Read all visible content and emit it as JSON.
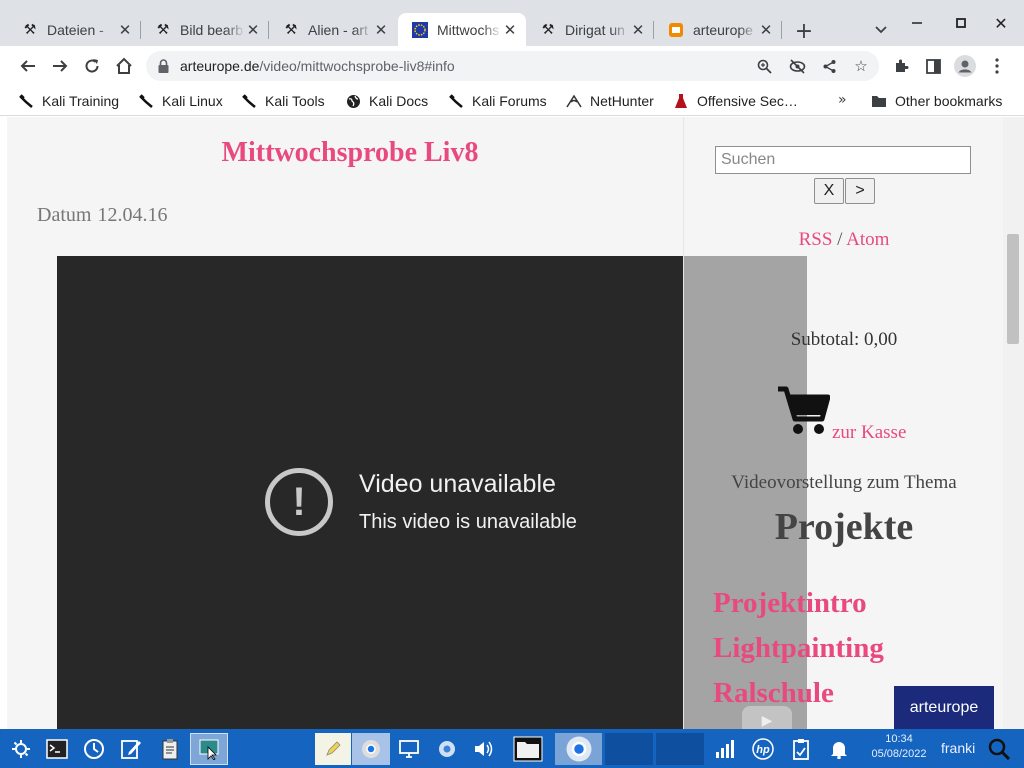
{
  "tabs": [
    {
      "title": "Dateien - ",
      "icon": "hammer-icon",
      "active": false
    },
    {
      "title": "Bild bearb",
      "icon": "hammer-icon",
      "active": false
    },
    {
      "title": "Alien - art",
      "icon": "hammer-icon",
      "active": false
    },
    {
      "title": "Mittwochs",
      "icon": "eu-flag-icon",
      "active": true
    },
    {
      "title": "Dirigat un",
      "icon": "hammer-icon",
      "active": false
    },
    {
      "title": "arteurope",
      "icon": "arteurope-icon",
      "active": false
    }
  ],
  "address": {
    "domain": "arteurope.de",
    "path": "/video/mittwochsprobe-liv8#info"
  },
  "bookmarks": [
    {
      "label": "Kali Training",
      "icon": "kali-dragon-icon"
    },
    {
      "label": "Kali Linux",
      "icon": "kali-dragon-icon"
    },
    {
      "label": "Kali Tools",
      "icon": "kali-dragon-icon"
    },
    {
      "label": "Kali Docs",
      "icon": "globe-icon"
    },
    {
      "label": "Kali Forums",
      "icon": "kali-dragon-icon"
    },
    {
      "label": "NetHunter",
      "icon": "nethunter-icon"
    },
    {
      "label": "Offensive Sec…",
      "icon": "offsec-icon"
    }
  ],
  "bookmarks_more": "»",
  "other_bookmarks": "Other bookmarks",
  "page": {
    "title": "Mittwochsprobe Liv8",
    "date_label": "Datum",
    "date_value": "12.04.16",
    "video_title": "Video unavailable",
    "video_subtitle": "This video is unavailable"
  },
  "sidebar": {
    "search_placeholder": "Suchen",
    "clear_button": "X",
    "submit_button": ">",
    "rss": "RSS",
    "feed_sep": "/",
    "atom": "Atom",
    "subtotal": "Subtotal: 0,00",
    "checkout": "zur Kasse",
    "intro_text": "Videovorstellung zum Thema",
    "heading": "Projekte",
    "links": [
      "Projektintro",
      "Lightpainting",
      "Ralschule"
    ],
    "logo_text": "arteurope"
  },
  "taskbar": {
    "time": "10:34",
    "date": "05/08/2022",
    "user": "franki"
  },
  "colors": {
    "accent_pink": "#e84a7f",
    "taskbar_blue": "#1565c0",
    "tabstrip": "#dee1e6",
    "video_bg": "#282828"
  }
}
